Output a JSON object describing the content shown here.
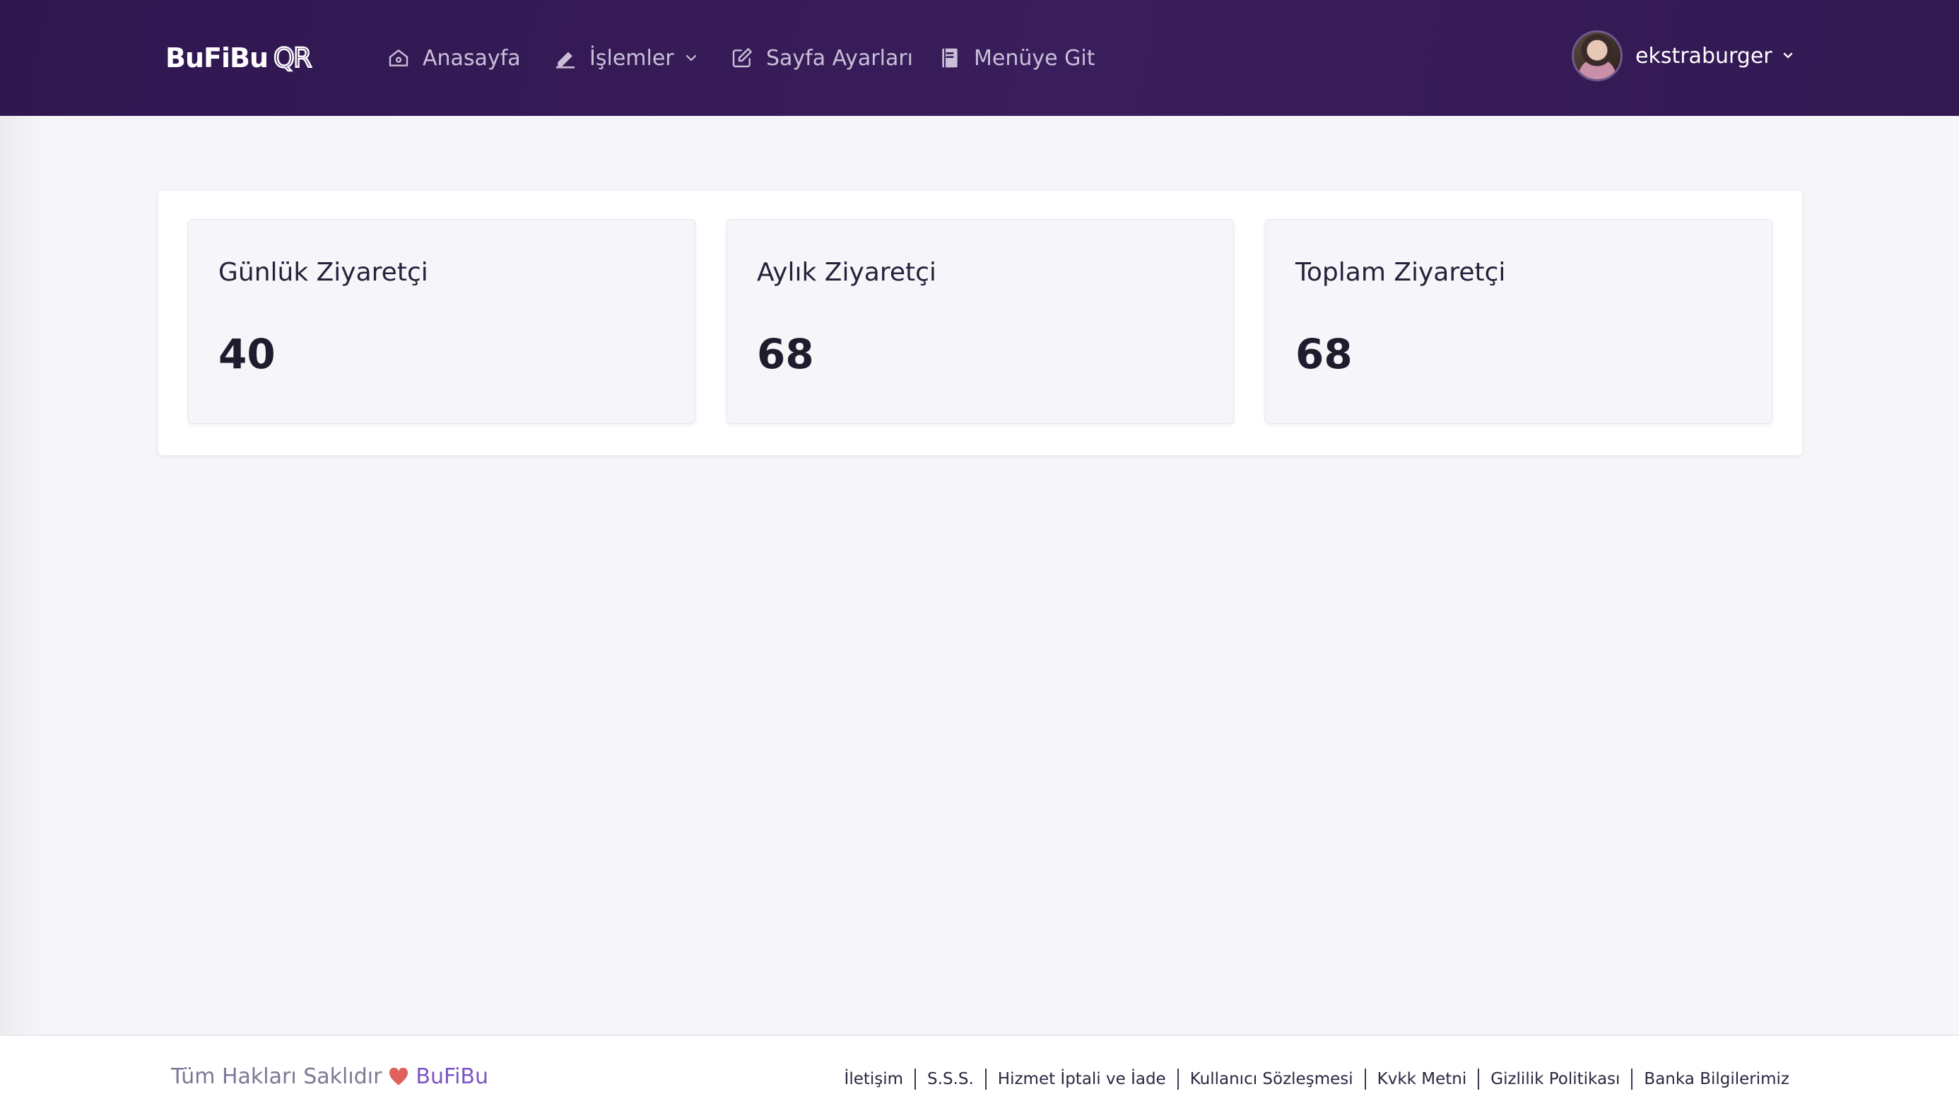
{
  "brand": {
    "name": "BuFiBu",
    "suffix": "QR"
  },
  "nav": {
    "items": [
      {
        "label": "Anasayfa",
        "icon": "home-icon"
      },
      {
        "label": "İşlemler",
        "icon": "pencil-icon",
        "has_dropdown": true
      },
      {
        "label": "Sayfa Ayarları",
        "icon": "edit-square-icon"
      },
      {
        "label": "Menüye Git",
        "icon": "book-icon"
      }
    ]
  },
  "user": {
    "name": "ekstraburger"
  },
  "stats": [
    {
      "title": "Günlük Ziyaretçi",
      "value": "40"
    },
    {
      "title": "Aylık Ziyaretçi",
      "value": "68"
    },
    {
      "title": "Toplam Ziyaretçi",
      "value": "68"
    }
  ],
  "footer": {
    "copyright": "Tüm Hakları Saklıdır",
    "brand": "BuFiBu",
    "links": [
      "İletişim",
      "S.S.S.",
      "Hizmet İptali ve İade",
      "Kullanıcı Sözleşmesi",
      "Kvkk Metni",
      "Gizlilik Politikası",
      "Banka Bilgilerimiz"
    ]
  },
  "colors": {
    "header_bg": "#3a1d5b",
    "page_bg": "#f6f5f9",
    "accent": "#7b54c7",
    "heart": "#e0605e"
  }
}
